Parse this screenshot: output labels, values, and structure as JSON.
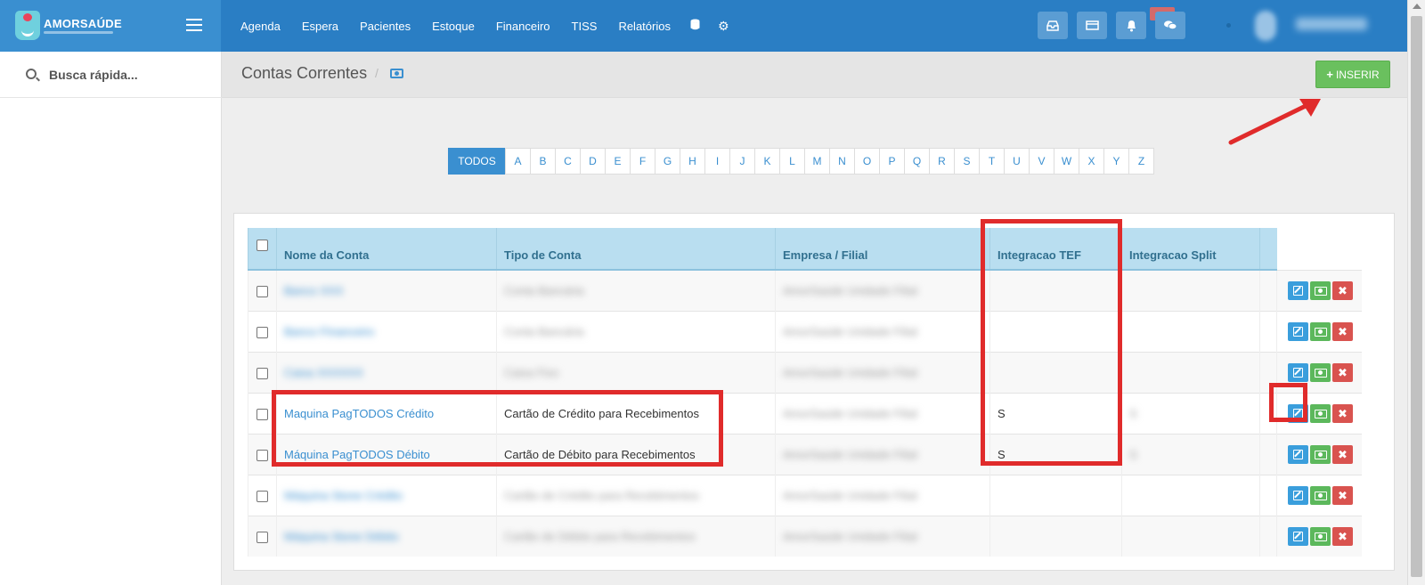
{
  "brand": {
    "name": "AMORSAÚDE"
  },
  "nav": {
    "items": [
      "Agenda",
      "Espera",
      "Pacientes",
      "Estoque",
      "Financeiro",
      "TISS",
      "Relatórios"
    ],
    "icons": [
      "database-icon",
      "gear-icon"
    ]
  },
  "search": {
    "placeholder": "Busca rápida..."
  },
  "page": {
    "title": "Contas Correntes",
    "separator": "/",
    "insert_label": "INSERIR"
  },
  "alphabet": [
    "TODOS",
    "A",
    "B",
    "C",
    "D",
    "E",
    "F",
    "G",
    "H",
    "I",
    "J",
    "K",
    "L",
    "M",
    "N",
    "O",
    "P",
    "Q",
    "R",
    "S",
    "T",
    "U",
    "V",
    "W",
    "X",
    "Y",
    "Z"
  ],
  "table": {
    "headers": [
      "Nome da Conta",
      "Tipo de Conta",
      "Empresa / Filial",
      "Integracao TEF",
      "Integracao Split"
    ],
    "rows": [
      {
        "name": "Banco XXX",
        "type": "Conta Bancária",
        "company": "AmorSaúde Unidade Filial",
        "tef": "",
        "split": "",
        "blurred": true
      },
      {
        "name": "Banco Financeiro",
        "type": "Conta Bancária",
        "company": "AmorSaúde Unidade Filial",
        "tef": "",
        "split": "",
        "blurred": true
      },
      {
        "name": "Caixa XXXXXX",
        "type": "Caixa Fixo",
        "company": "AmorSaúde Unidade Filial",
        "tef": "",
        "split": "",
        "blurred": true
      },
      {
        "name": "Maquina PagTODOS Crédito",
        "type": "Cartão de Crédito para Recebimentos",
        "company": "AmorSaúde Unidade Filial",
        "tef": "S",
        "split": "S",
        "blurred": false
      },
      {
        "name": "Máquina PagTODOS Débito",
        "type": "Cartão de Débito para Recebimentos",
        "company": "AmorSaúde Unidade Filial",
        "tef": "S",
        "split": "S",
        "blurred": false
      },
      {
        "name": "Máquina Stone Crédito",
        "type": "Cartão de Crédito para Recebimentos",
        "company": "AmorSaúde Unidade Filial",
        "tef": "",
        "split": "",
        "blurred": true
      },
      {
        "name": "Máquina Stone Débito",
        "type": "Cartão de Débito para Recebimentos",
        "company": "AmorSaúde Unidade Filial",
        "tef": "",
        "split": "",
        "blurred": true
      }
    ]
  },
  "colors": {
    "topbar": "#2a7ec4",
    "accent": "#3a8fd0",
    "success": "#6ac05e",
    "danger": "#d9534f",
    "annotation": "#e02b2b"
  }
}
